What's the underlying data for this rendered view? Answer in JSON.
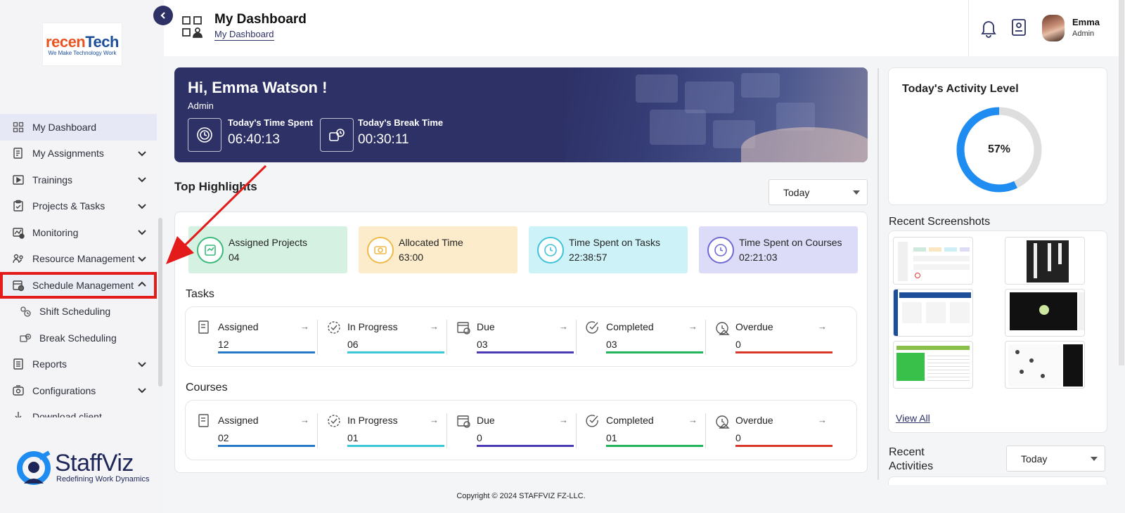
{
  "sidebar": {
    "logo_text_a": "recen",
    "logo_text_b": "Tech",
    "logo_tagline": "We Make Technology Work",
    "items": [
      {
        "label": "My Dashboard"
      },
      {
        "label": "My Assignments"
      },
      {
        "label": "Trainings"
      },
      {
        "label": "Projects & Tasks"
      },
      {
        "label": "Monitoring"
      },
      {
        "label": "Resource Management"
      },
      {
        "label": "Schedule Management"
      },
      {
        "label": "Shift Scheduling"
      },
      {
        "label": "Break Scheduling"
      },
      {
        "label": "Reports"
      },
      {
        "label": "Configurations"
      },
      {
        "label": "Download client"
      }
    ],
    "brand_name": "StaffViz",
    "brand_tagline": "Redefining Work Dynamics"
  },
  "header": {
    "title": "My Dashboard",
    "breadcrumb": "My Dashboard",
    "user_name": "Emma",
    "user_role": "Admin"
  },
  "banner": {
    "greeting": "Hi, Emma Watson !",
    "role": "Admin",
    "time_spent_label": "Today's Time Spent",
    "time_spent_value": "06:40:13",
    "break_label": "Today's Break Time",
    "break_value": "00:30:11"
  },
  "highlights": {
    "title": "Top Highlights",
    "filter": "Today",
    "cards": [
      {
        "label": "Assigned Projects",
        "value": "04",
        "bg": "#d4f1e2",
        "accent": "#3cb97c"
      },
      {
        "label": "Allocated Time",
        "value": "63:00",
        "bg": "#fdeccc",
        "accent": "#f0b94a"
      },
      {
        "label": "Time Spent on Tasks",
        "value": "22:38:57",
        "bg": "#cdf2f8",
        "accent": "#3fc3d8"
      },
      {
        "label": "Time Spent on Courses",
        "value": "02:21:03",
        "bg": "#dcdcf8",
        "accent": "#6f6ad6"
      }
    ]
  },
  "tasks": {
    "title": "Tasks",
    "stats": [
      {
        "label": "Assigned",
        "value": "12",
        "color": "#2979c9"
      },
      {
        "label": "In Progress",
        "value": "06",
        "color": "#3bc8d8"
      },
      {
        "label": "Due",
        "value": "03",
        "color": "#4b3ab5"
      },
      {
        "label": "Completed",
        "value": "03",
        "color": "#22b55a"
      },
      {
        "label": "Overdue",
        "value": "0",
        "color": "#d6392a"
      }
    ]
  },
  "courses": {
    "title": "Courses",
    "stats": [
      {
        "label": "Assigned",
        "value": "02",
        "color": "#2979c9"
      },
      {
        "label": "In Progress",
        "value": "01",
        "color": "#3bc8d8"
      },
      {
        "label": "Due",
        "value": "0",
        "color": "#4b3ab5"
      },
      {
        "label": "Completed",
        "value": "01",
        "color": "#22b55a"
      },
      {
        "label": "Overdue",
        "value": "0",
        "color": "#d6392a"
      }
    ]
  },
  "activity": {
    "title": "Today's Activity Level",
    "percent_label": "57%",
    "percent": 57,
    "color": "#1e8cf0"
  },
  "screenshots": {
    "title": "Recent Screenshots",
    "view_all": "View All"
  },
  "recent_activities": {
    "title": "Recent Activities",
    "filter": "Today"
  },
  "footer": {
    "copyright": "Copyright © 2024 STAFFVIZ FZ-LLC."
  },
  "icons": [
    "grid-user-icon",
    "bell-icon",
    "book-icon",
    "chevron-left-icon",
    "chevron-down-icon",
    "chevron-up-icon",
    "clock-icon",
    "coffee-icon",
    "arrow-right-icon"
  ]
}
